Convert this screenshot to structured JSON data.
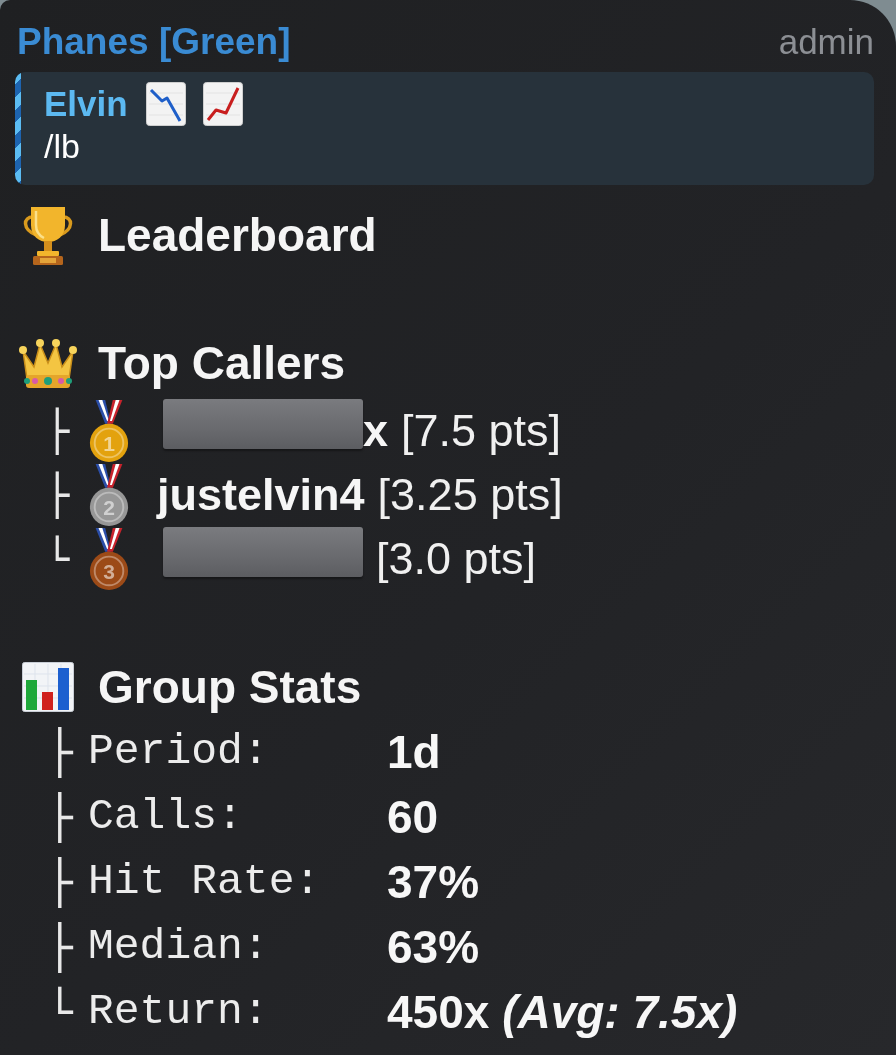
{
  "message": {
    "sender": "Phanes [Green]",
    "role": "admin"
  },
  "reply": {
    "name": "Elvin",
    "text": "/lb"
  },
  "title": "Leaderboard",
  "sections": [
    {
      "kind": "callers",
      "heading": "Top Callers",
      "items": [
        {
          "branch": "├",
          "rank": "1",
          "color": "#e3a20e",
          "redacted": true,
          "name": "x",
          "score": "[7.5 pts]"
        },
        {
          "branch": "├",
          "rank": "2",
          "color": "#979797",
          "redacted": false,
          "name": "justelvin4",
          "score": "[3.25 pts]"
        },
        {
          "branch": "└",
          "rank": "3",
          "color": "#9c4a17",
          "redacted": true,
          "score": "[3.0 pts]"
        }
      ]
    },
    {
      "kind": "stats",
      "heading": "Group Stats",
      "items": [
        {
          "branch": "├",
          "label": "Period:",
          "value": "1d"
        },
        {
          "branch": "├",
          "label": "Calls:",
          "value": "60"
        },
        {
          "branch": "├",
          "label": "Hit Rate:",
          "value": "37%"
        },
        {
          "branch": "├",
          "label": "Median:",
          "value": "63%"
        },
        {
          "branch": "└",
          "label": "Return:",
          "value": "450x *(Avg: 7.5x)*"
        }
      ]
    }
  ]
}
